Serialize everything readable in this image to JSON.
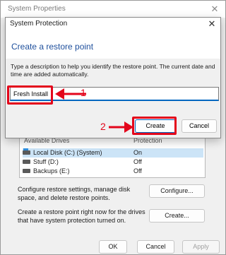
{
  "background_window": {
    "title": "System Properties",
    "close_glyph": "✕",
    "drives_header": {
      "col1": "Available Drives",
      "col2": "Protection"
    },
    "drives": [
      {
        "name": "Local Disk (C:) (System)",
        "protection": "On",
        "icon": "system-drive-icon"
      },
      {
        "name": "Stuff (D:)",
        "protection": "Off",
        "icon": "drive-icon"
      },
      {
        "name": "Backups (E:)",
        "protection": "Off",
        "icon": "drive-icon"
      }
    ],
    "configure_text": "Configure restore settings, manage disk space, and delete restore points.",
    "configure_button": "Configure...",
    "create_text": "Create a restore point right now for the drives that have system protection turned on.",
    "create_button": "Create...",
    "ok_button": "OK",
    "cancel_button": "Cancel",
    "apply_button": "Apply"
  },
  "dialog": {
    "title": "System Protection",
    "close_glyph": "✕",
    "heading": "Create a restore point",
    "description": "Type a description to help you identify the restore point. The current date and time are added automatically.",
    "input_value": "Fresh Install",
    "create_button": "Create",
    "cancel_button": "Cancel"
  },
  "annotations": {
    "step1": "1",
    "step2": "2",
    "color": "#e3051b"
  }
}
